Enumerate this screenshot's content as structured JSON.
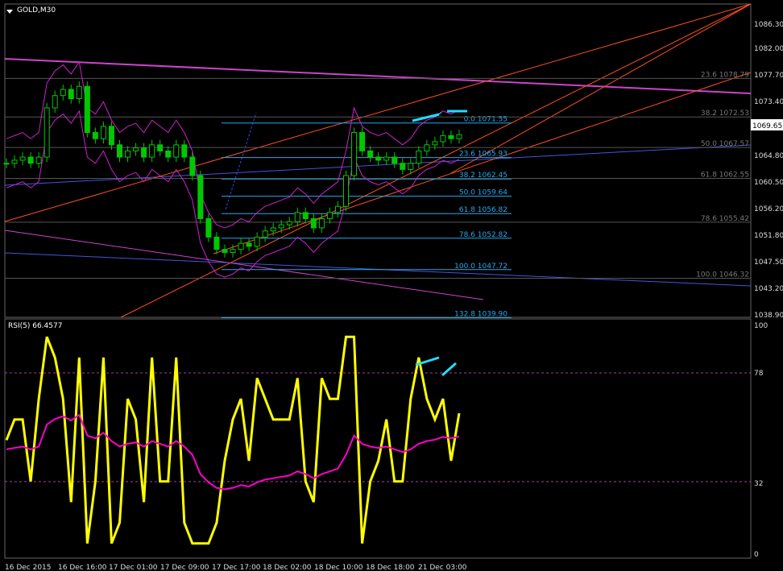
{
  "chart_data": {
    "type": "candlestick",
    "symbol_label": "GOLD,M30",
    "rsi_label": "RSI(5) 66.4577",
    "last_price": "1069.65",
    "price_ticks": [
      "1086.30",
      "1082.00",
      "1077.70",
      "1073.40",
      "1069.65",
      "1064.80",
      "1060.50",
      "1056.20",
      "1051.80",
      "1047.50",
      "1043.20",
      "1038.90"
    ],
    "rsi_ticks": [
      "100",
      "78",
      "32",
      "0"
    ],
    "time_ticks": [
      "16 Dec 2015",
      "16 Dec 16:00",
      "17 Dec 01:00",
      "17 Dec 09:00",
      "17 Dec 17:00",
      "18 Dec 02:00",
      "18 Dec 10:00",
      "18 Dec 18:00",
      "21 Dec 03:00"
    ],
    "fib_main": [
      {
        "label": "0.0 1071.55",
        "price": 1071.55
      },
      {
        "label": "23.6 1065.93",
        "price": 1065.93
      },
      {
        "label": "38.2 1062.45",
        "price": 1062.45
      },
      {
        "label": "50.0 1059.64",
        "price": 1059.64
      },
      {
        "label": "61.8 1056.82",
        "price": 1056.82
      },
      {
        "label": "78.6 1052.82",
        "price": 1052.82
      },
      {
        "label": "100.0 1047.72",
        "price": 1047.72
      },
      {
        "label": "132.8 1039.90",
        "price": 1039.9
      }
    ],
    "fib_right": [
      {
        "label": "23.6 1078.79",
        "price": 1078.79
      },
      {
        "label": "38.2 1072.53",
        "price": 1072.53
      },
      {
        "label": "50.0 1067.57",
        "price": 1067.57
      },
      {
        "label": "61.8 1062.55",
        "price": 1062.55
      },
      {
        "label": "78.6 1055.42",
        "price": 1055.42
      },
      {
        "label": "100.0 1046.32",
        "price": 1046.32
      }
    ],
    "close_path": [
      1065,
      1065.5,
      1066,
      1065,
      1066,
      1074,
      1076,
      1077,
      1075.5,
      1077.5,
      1070,
      1069,
      1071,
      1068,
      1066,
      1067,
      1067.5,
      1066,
      1068,
      1067,
      1066,
      1068,
      1066,
      1063,
      1056,
      1053,
      1051,
      1050.5,
      1051,
      1052,
      1051.5,
      1053,
      1054,
      1054.5,
      1055,
      1055.5,
      1057,
      1056,
      1054.5,
      1056,
      1057,
      1058,
      1063,
      1070,
      1067,
      1066,
      1065.5,
      1066,
      1065,
      1064,
      1065,
      1067,
      1068,
      1068.5,
      1069.5,
      1069,
      1069.65
    ],
    "colors": {
      "bull": "#00c800",
      "bear": "#00c800",
      "bands": "#d020d0",
      "fib": "#22aaee",
      "trend": "#ff5020",
      "rsi": "#ffff00"
    }
  }
}
